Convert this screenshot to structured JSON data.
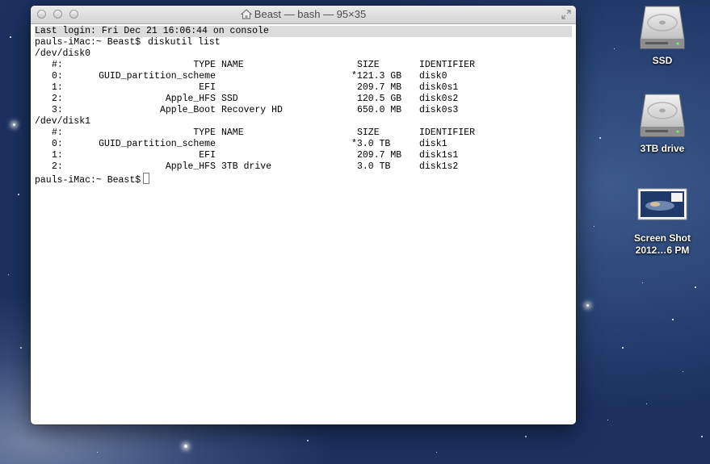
{
  "window": {
    "title": "Beast — bash — 95×35"
  },
  "terminal": {
    "last_login": "Last login: Fri Dec 21 16:06:44 on console",
    "prompt": "pauls-iMac:~ Beast$",
    "command": "diskutil list",
    "headers": {
      "num": "#:",
      "type": "TYPE",
      "name": "NAME",
      "size": "SIZE",
      "identifier": "IDENTIFIER"
    },
    "disks": [
      {
        "device": "/dev/disk0",
        "partitions": [
          {
            "num": "0:",
            "type": "GUID_partition_scheme",
            "name": "",
            "size": "*121.3 GB",
            "identifier": "disk0"
          },
          {
            "num": "1:",
            "type": "EFI",
            "name": "",
            "size": "209.7 MB",
            "identifier": "disk0s1"
          },
          {
            "num": "2:",
            "type": "Apple_HFS",
            "name": "SSD",
            "size": "120.5 GB",
            "identifier": "disk0s2"
          },
          {
            "num": "3:",
            "type": "Apple_Boot",
            "name": "Recovery HD",
            "size": "650.0 MB",
            "identifier": "disk0s3"
          }
        ]
      },
      {
        "device": "/dev/disk1",
        "partitions": [
          {
            "num": "0:",
            "type": "GUID_partition_scheme",
            "name": "",
            "size": "*3.0 TB",
            "identifier": "disk1"
          },
          {
            "num": "1:",
            "type": "EFI",
            "name": "",
            "size": "209.7 MB",
            "identifier": "disk1s1"
          },
          {
            "num": "2:",
            "type": "Apple_HFS",
            "name": "3TB drive",
            "size": "3.0 TB",
            "identifier": "disk1s2"
          }
        ]
      }
    ]
  },
  "desktop": {
    "items": [
      {
        "label": "SSD",
        "icon": "hard-drive-icon"
      },
      {
        "label": "3TB drive",
        "icon": "hard-drive-icon"
      },
      {
        "label_line1": "Screen Shot",
        "label_line2": "2012…6 PM",
        "icon": "screenshot-thumbnail-icon"
      }
    ]
  }
}
